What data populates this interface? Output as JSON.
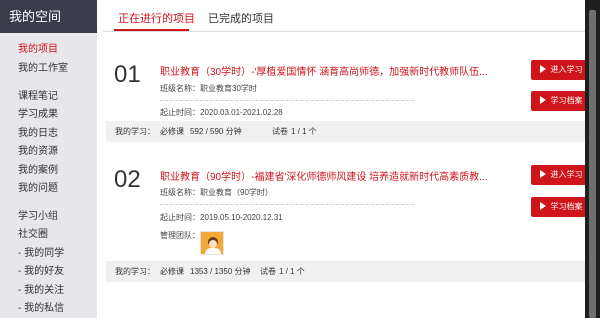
{
  "sidebar": {
    "title": "我的空间",
    "items": [
      {
        "label": "我的项目",
        "active": true
      },
      {
        "label": "我的工作室"
      },
      {
        "label": "课程笔记"
      },
      {
        "label": "学习成果"
      },
      {
        "label": "我的日志"
      },
      {
        "label": "我的资源"
      },
      {
        "label": "我的案例"
      },
      {
        "label": "我的问题"
      },
      {
        "label": "学习小组"
      },
      {
        "label": "社交圈"
      },
      {
        "label": "- 我的同学"
      },
      {
        "label": "- 我的好友"
      },
      {
        "label": "- 我的关注"
      },
      {
        "label": "- 我的私信"
      }
    ]
  },
  "tabs": [
    {
      "label": "正在进行的项目",
      "active": true
    },
    {
      "label": "已完成的项目"
    }
  ],
  "projects": [
    {
      "number": "01",
      "title": "职业教育（30学时）-'厚植爱国情怀 涵育高尚师德，加强新时代教师队伍...",
      "class_name": "班级名称：职业教育30学时",
      "period": "起止时间：2020.03.01-2021.02.28",
      "enter_label": "进入学习",
      "archive_label": "学习档案",
      "my_study_label": "我的学习：",
      "required_label": "必修课",
      "required_value": "592 / 590 分钟",
      "exam_label": "试卷",
      "exam_value": "1 / 1 个"
    },
    {
      "number": "02",
      "title": "职业教育（90学时）-福建省'深化师德师风建设 培养造就新时代高素质教...",
      "class_name": "班级名称：职业教育（90学时）",
      "period": "起止时间：2019.05.10-2020.12.31",
      "team_label": "管理团队：",
      "enter_label": "进入学习",
      "archive_label": "学习档案",
      "my_study_label": "我的学习：",
      "required_label": "必修课",
      "required_value": "1353 / 1350 分钟",
      "exam_label": "试卷",
      "exam_value": "1 / 1 个"
    }
  ],
  "colors": {
    "accent": "#d0141b",
    "sidebar_header": "#3a3d49",
    "sidebar_bg": "#e6e6eb"
  },
  "icons": {
    "button_icon": "play-icon",
    "team_avatar": "avatar-icon"
  }
}
